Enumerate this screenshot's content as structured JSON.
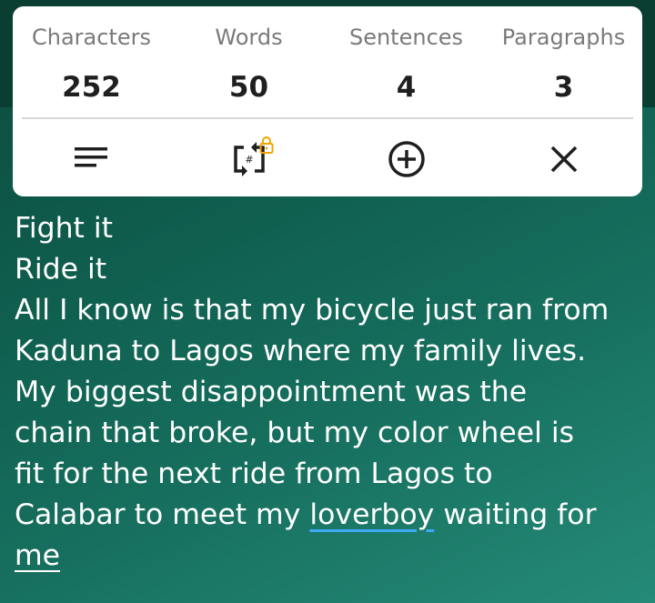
{
  "stats": [
    {
      "label": "Characters",
      "value": "252"
    },
    {
      "label": "Words",
      "value": "50"
    },
    {
      "label": "Sentences",
      "value": "4"
    },
    {
      "label": "Paragraphs",
      "value": "3"
    }
  ],
  "toolbar": {
    "icons": [
      "menu-lines-icon",
      "hash-swap-icon",
      "lock-icon",
      "add-circle-icon",
      "close-icon"
    ],
    "accent_lock": "#f0a500"
  },
  "colors": {
    "background_top": "#0b3e33",
    "background": "#0f5e4e",
    "card": "#ffffff",
    "spellcheck_underline": "#3fa9f5"
  },
  "text": {
    "line1": "Fight it",
    "line2": "Ride it",
    "line3": "All I know is that my bicycle just ran from",
    "line4": "Kaduna to Lagos where my family lives.",
    "line5": "My biggest disappointment was the",
    "line6": "chain that broke, but my color wheel is",
    "line7": "fit for the next ride from Lagos to",
    "line8_prefix": "Calabar to meet my ",
    "line8_underlined": "loverboy",
    "line8_suffix": " waiting for",
    "line9": "me"
  }
}
